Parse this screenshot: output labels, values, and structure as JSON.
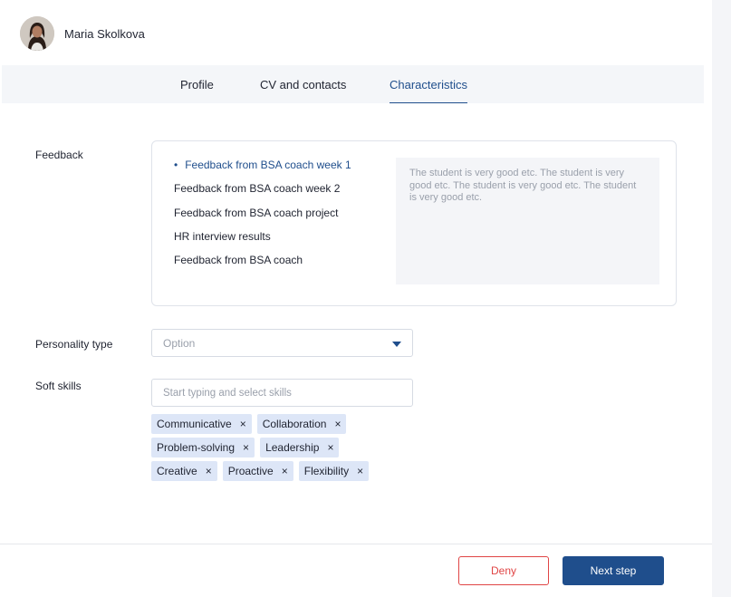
{
  "user": {
    "name": "Maria Skolkova"
  },
  "tabs": [
    {
      "label": "Profile"
    },
    {
      "label": "CV and contacts"
    },
    {
      "label": "Characteristics"
    }
  ],
  "active_tab": "Characteristics",
  "feedback": {
    "label": "Feedback",
    "items": [
      {
        "label": "Feedback from BSA coach week 1",
        "active": true
      },
      {
        "label": "Feedback from BSA coach week 2",
        "active": false
      },
      {
        "label": "Feedback from BSA coach project",
        "active": false
      },
      {
        "label": "HR interview results",
        "active": false
      },
      {
        "label": "Feedback from BSA coach",
        "active": false
      }
    ],
    "text": "The student is very good etc. The student is very good etc. The student is very good etc. The student is very good etc."
  },
  "personality": {
    "label": "Personality type",
    "placeholder": "Option"
  },
  "soft_skills": {
    "label": "Soft skills",
    "placeholder": "Start typing and select skills",
    "chip_rows": [
      [
        "Communicative",
        "Collaboration"
      ],
      [
        "Problem-solving",
        "Leadership"
      ],
      [
        "Creative",
        "Proactive",
        "Flexibility"
      ]
    ],
    "remove_glyph": "×"
  },
  "actions": {
    "deny_label": "Deny",
    "next_label": "Next step"
  },
  "colors": {
    "primary": "#1f4e8c",
    "danger": "#e04545",
    "chip_bg": "#dde6f7",
    "tabbar_bg": "#f4f6f9"
  },
  "icons": {
    "avatar": "user-photo-icon",
    "select_caret": "caret-down-icon",
    "chip_remove": "close-icon"
  }
}
